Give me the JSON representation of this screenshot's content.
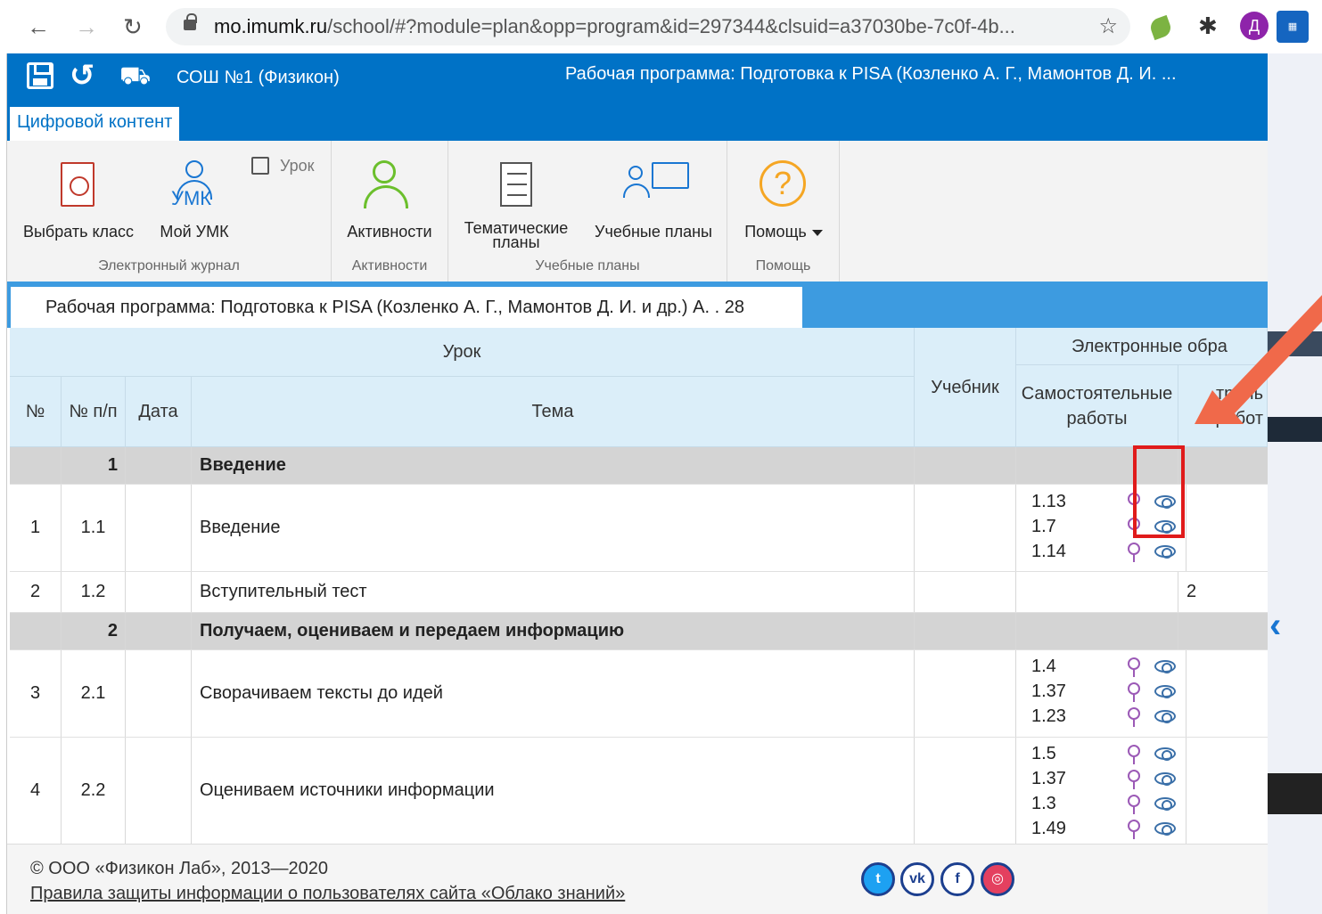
{
  "browser": {
    "url_host": "mo.imumk.ru",
    "url_path": "/school/#?module=plan&opp=program&id=297344&clsuid=a37030be-7c0f-4b...",
    "avatar_letter": "Д"
  },
  "header": {
    "school": "СОШ №1 (Физикон)",
    "program_title": "Рабочая программа: Подготовка к PISA (Козленко А. Г., Мамонтов Д. И. ...",
    "tab": "Цифровой контент",
    "brand_color": "#0072c6"
  },
  "ribbon": {
    "choose_class": "Выбрать класс",
    "my_umk": "Мой УМК",
    "umk_icon_text": "УМК",
    "lesson": "Урок",
    "group_journal": "Электронный журнал",
    "activities": "Активности",
    "group_activities": "Активности",
    "thematic_plans_1": "Тематические",
    "thematic_plans_2": "планы",
    "study_plans": "Учебные планы",
    "group_plans": "Учебные планы",
    "help": "Помощь",
    "group_help": "Помощь"
  },
  "program_tab": "Рабочая программа: Подготовка к PISA (Козленко А. Г., Мамонтов Д. И. и др.) А. . 28",
  "table": {
    "headers": {
      "lesson": "Урок",
      "num": "№",
      "num_pp": "№ п/п",
      "date": "Дата",
      "topic": "Тема",
      "textbook": "Учебник",
      "eor": "Электронные обра",
      "self_work_1": "Самостоятельные",
      "self_work_2": "работы",
      "control_1": "троль",
      "control_2": "работ"
    },
    "rows": [
      {
        "type": "section",
        "pp": "1",
        "topic": "Введение"
      },
      {
        "type": "lesson",
        "num": "1",
        "pp": "1.1",
        "topic": "Введение",
        "works": [
          "1.13",
          "1.7",
          "1.14"
        ]
      },
      {
        "type": "lesson",
        "num": "2",
        "pp": "1.2",
        "topic": "Вступительный тест",
        "control": "2"
      },
      {
        "type": "section",
        "pp": "2",
        "topic": "Получаем, оцениваем и передаем информацию"
      },
      {
        "type": "lesson",
        "num": "3",
        "pp": "2.1",
        "topic": "Сворачиваем тексты до идей",
        "works": [
          "1.4",
          "1.37",
          "1.23"
        ]
      },
      {
        "type": "lesson",
        "num": "4",
        "pp": "2.2",
        "topic": "Оцениваем источники информации",
        "works": [
          "1.5",
          "1.37",
          "1.3",
          "1.49"
        ]
      }
    ]
  },
  "footer": {
    "copyright": "© ООО «Физикон Лаб», 2013—2020",
    "privacy": "Правила защиты информации о пользователях сайта «Облако знаний»"
  },
  "annotation": {
    "highlight_color": "#e01b1b",
    "arrow_color": "#f0694a"
  }
}
